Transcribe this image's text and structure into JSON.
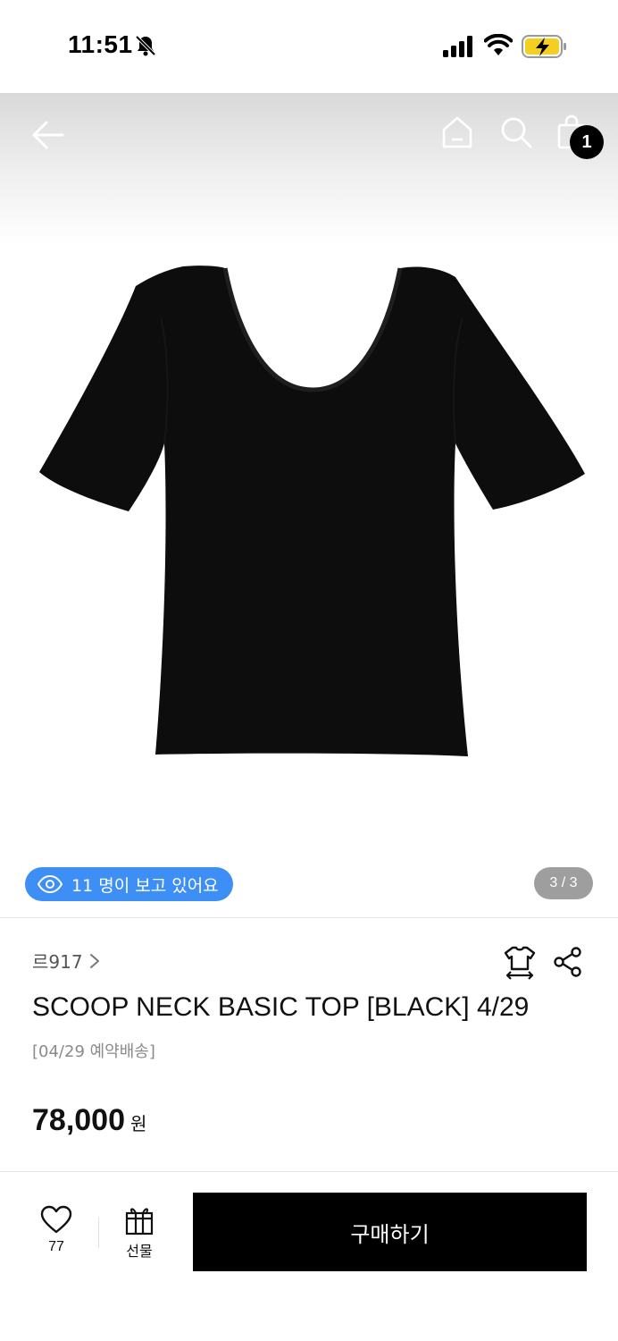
{
  "status_bar": {
    "time": "11:51",
    "icons": [
      "bell-slash-icon",
      "signal-icon",
      "wifi-icon",
      "battery-charging-icon"
    ],
    "battery_color": "#f5cf20"
  },
  "header": {
    "icons": [
      "back-arrow-icon",
      "home-icon",
      "search-icon",
      "cart-icon"
    ],
    "cart_count": "1"
  },
  "gallery": {
    "viewers_text": "11 명이 보고 있어요",
    "viewers_pill_color": "#3d8ff5",
    "page_indicator": "3 / 3"
  },
  "product": {
    "brand": "르917",
    "title": "SCOOP NECK BASIC TOP [BLACK] 4/29",
    "subtitle": "[04/29 예약배송]",
    "price": "78,000",
    "price_unit": "원"
  },
  "bottom_bar": {
    "like_count": "77",
    "gift_label": "선물",
    "buy_label": "구매하기"
  }
}
